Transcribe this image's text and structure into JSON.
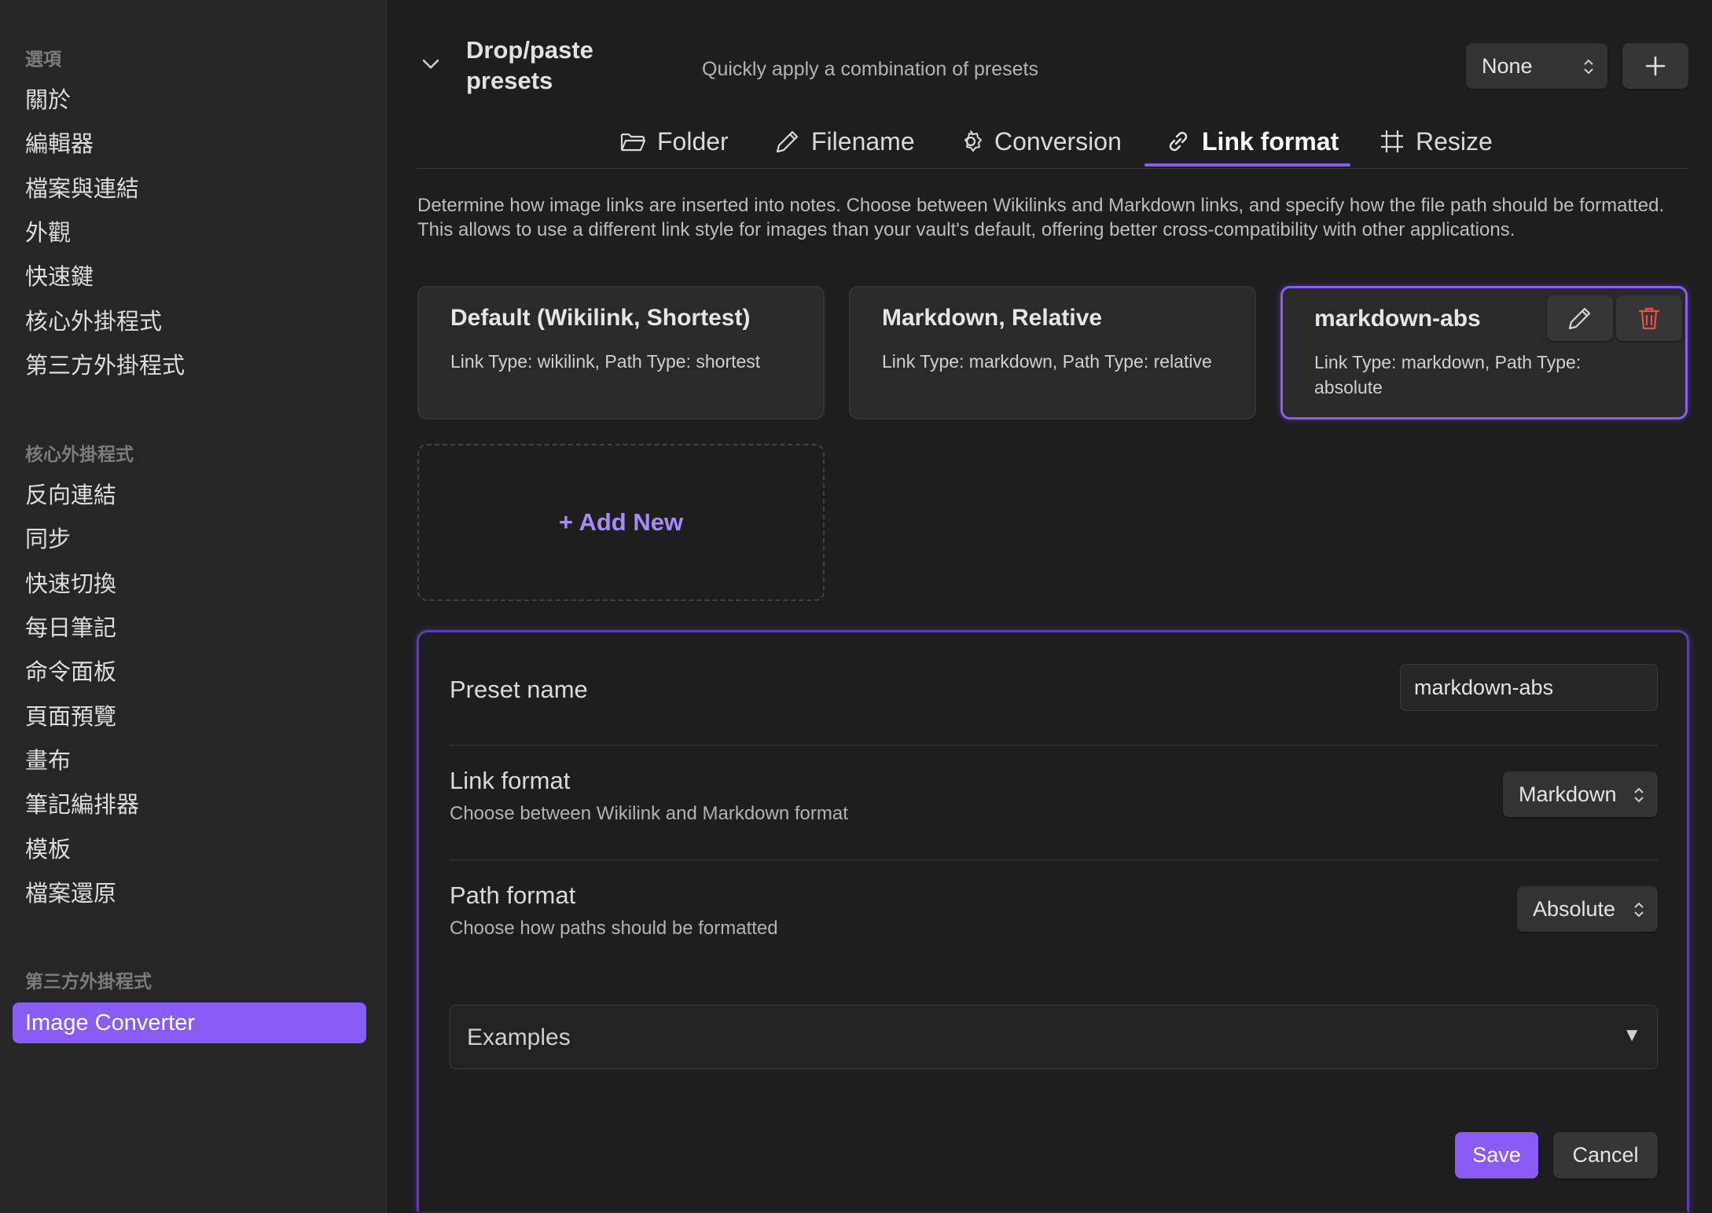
{
  "sidebar": {
    "sections": [
      {
        "heading": "選項",
        "items": [
          "關於",
          "編輯器",
          "檔案與連結",
          "外觀",
          "快速鍵",
          "核心外掛程式",
          "第三方外掛程式"
        ]
      },
      {
        "heading": "核心外掛程式",
        "items": [
          "反向連結",
          "同步",
          "快速切換",
          "每日筆記",
          "命令面板",
          "頁面預覽",
          "畫布",
          "筆記編排器",
          "模板",
          "檔案還原"
        ]
      },
      {
        "heading": "第三方外掛程式",
        "items": [
          "Image Converter"
        ]
      }
    ],
    "active_item": "Image Converter"
  },
  "header": {
    "title_line1": "Drop/paste",
    "title_line2": "presets",
    "description": "Quickly apply a combination of presets",
    "preset_select_value": "None",
    "add_button_icon": "plus-icon"
  },
  "tabs": [
    {
      "label": "Folder",
      "icon": "folder-icon"
    },
    {
      "label": "Filename",
      "icon": "pencil-icon"
    },
    {
      "label": "Conversion",
      "icon": "gear-icon"
    },
    {
      "label": "Link format",
      "icon": "link-icon",
      "active": true
    },
    {
      "label": "Resize",
      "icon": "crop-icon"
    }
  ],
  "intro_text": "Determine how image links are inserted into notes. Choose between Wikilinks and Markdown links, and specify how the file path should be formatted. This allows to use a different link style for images than your vault's default, offering better cross-compatibility with other applications.",
  "cards": [
    {
      "title": "Default (Wikilink, Shortest)",
      "desc": "Link Type: wikilink, Path Type: shortest"
    },
    {
      "title": "Markdown, Relative",
      "desc": "Link Type: markdown, Path Type: relative"
    },
    {
      "title": "markdown-abs",
      "desc": "Link Type: markdown, Path Type: absolute",
      "selected": true
    }
  ],
  "add_new_label": "+ Add New",
  "editor": {
    "preset_name_label": "Preset name",
    "preset_name_value": "markdown-abs",
    "link_format_label": "Link format",
    "link_format_desc": "Choose between Wikilink and Markdown format",
    "link_format_value": "Markdown",
    "path_format_label": "Path format",
    "path_format_desc": "Choose how paths should be formatted",
    "path_format_value": "Absolute",
    "examples_label": "Examples",
    "examples_caret": "▼",
    "save_label": "Save",
    "cancel_label": "Cancel"
  },
  "colors": {
    "accent": "#8a5cf5",
    "accent_text": "#a88bfa",
    "background": "#1e1e1e",
    "sidebar": "#262626",
    "danger": "#e5534b"
  }
}
